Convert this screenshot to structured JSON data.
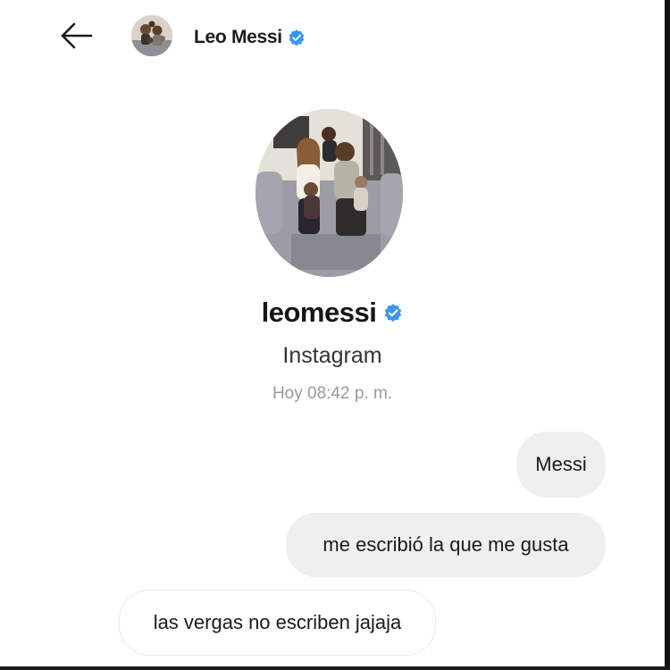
{
  "header": {
    "back_icon": "arrow-left-icon",
    "contact_name": "Leo Messi",
    "verified_icon": "verified-badge-icon",
    "avatar": "family-photo-avatar"
  },
  "profile": {
    "photo": "family-photo-on-sofa",
    "username": "leomessi",
    "verified_icon": "verified-badge-icon",
    "source": "Instagram",
    "timestamp": "Hoy 08:42 p. m."
  },
  "messages": [
    {
      "side": "outgoing",
      "text": "Messi"
    },
    {
      "side": "outgoing",
      "text": "me escribió la que me gusta"
    },
    {
      "side": "incoming",
      "text": "las vergas no escriben jajaja"
    }
  ],
  "colors": {
    "verified": "#3897f0",
    "bubble_outgoing": "#efefef",
    "bubble_incoming_border": "#eaeaea",
    "timestamp": "#9a9a9a"
  }
}
